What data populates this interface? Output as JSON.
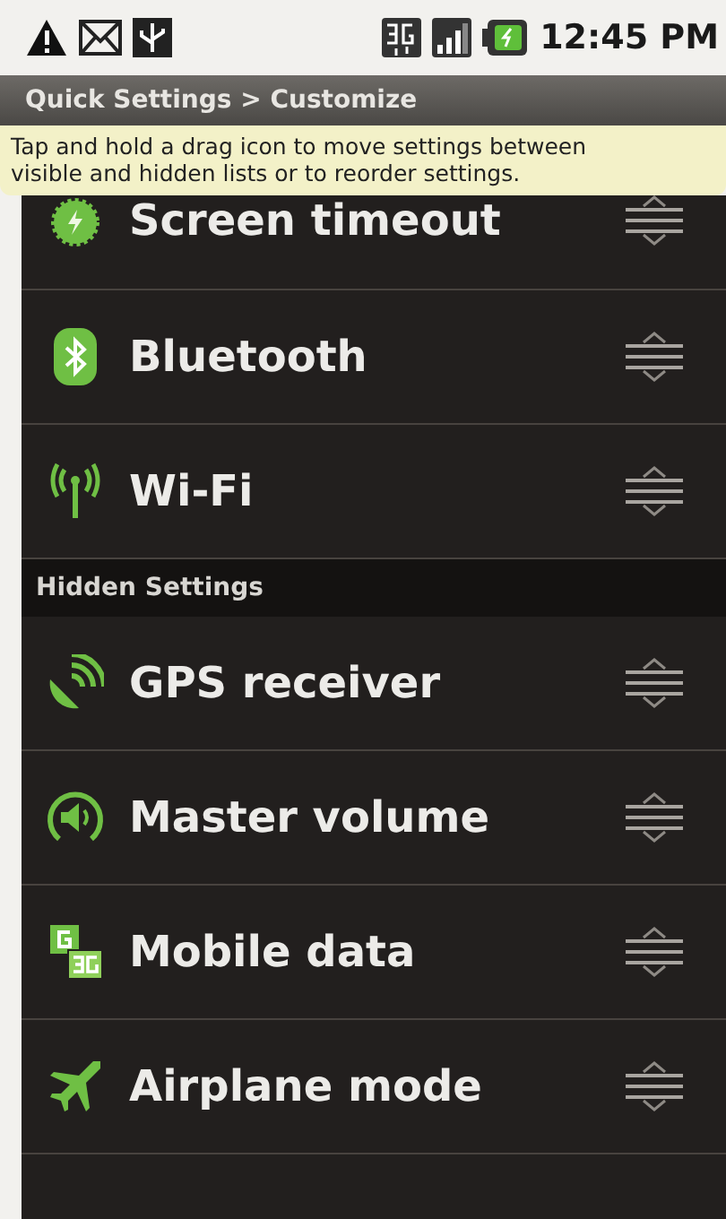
{
  "status_bar": {
    "time": "12:45 PM"
  },
  "title": "Quick Settings > Customize",
  "hint": "Tap and hold a drag icon to move settings between visible and hidden lists or to reorder settings.",
  "visible_settings": [
    {
      "kind": "timeout",
      "label": "Screen timeout"
    },
    {
      "kind": "bluetooth",
      "label": "Bluetooth"
    },
    {
      "kind": "wifi",
      "label": "Wi-Fi"
    }
  ],
  "hidden_section": {
    "title": "Hidden Settings",
    "settings": [
      {
        "kind": "gps",
        "label": "GPS receiver"
      },
      {
        "kind": "volume",
        "label": "Master volume"
      },
      {
        "kind": "mobile",
        "label": "Mobile data"
      },
      {
        "kind": "airplane",
        "label": "Airplane mode"
      }
    ]
  }
}
